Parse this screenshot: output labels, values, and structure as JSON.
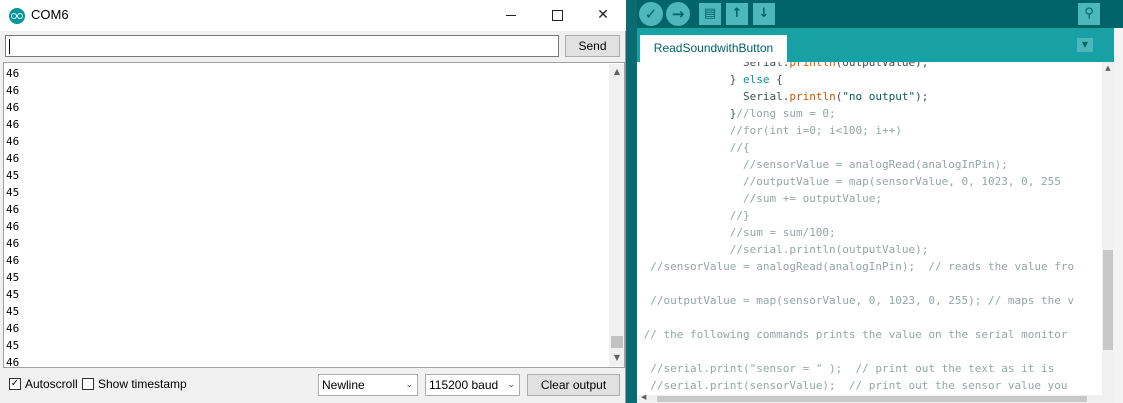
{
  "serial_monitor": {
    "title": "COM6",
    "input_value": "",
    "send_label": "Send",
    "output_lines": [
      "46",
      "46",
      "46",
      "46",
      "46",
      "46",
      "45",
      "45",
      "46",
      "46",
      "46",
      "46",
      "45",
      "45",
      "45",
      "46",
      "45",
      "46"
    ],
    "autoscroll_label": "Autoscroll",
    "autoscroll_checked": "✓",
    "timestamp_label": "Show timestamp",
    "line_ending": "Newline",
    "baud_rate": "115200 baud",
    "clear_label": "Clear output",
    "window_buttons": {
      "close": "✕"
    }
  },
  "ide": {
    "tab_label": "ReadSoundwithButton",
    "tab_menu_icon": "▼",
    "toolbar": {
      "verify": "✓",
      "upload": "→",
      "new": "▤",
      "open": "↑",
      "save": "↓",
      "serial_monitor": "⚲"
    }
  }
}
